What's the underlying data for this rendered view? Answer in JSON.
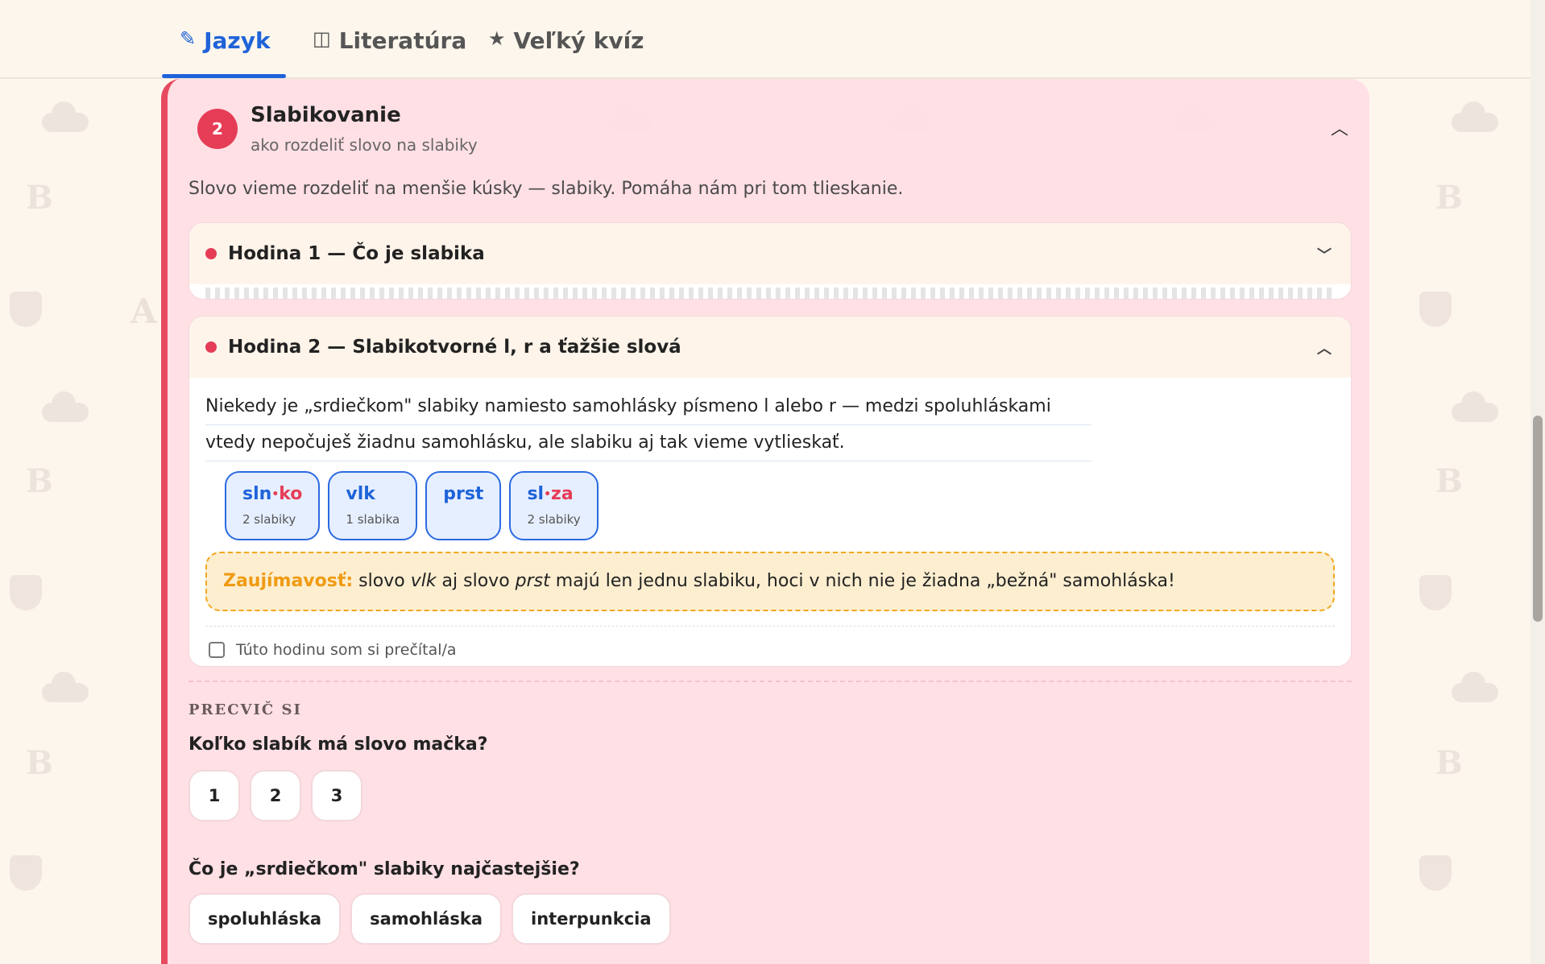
{
  "tabs": [
    {
      "label": "Jazyk",
      "icon": "pencil-icon",
      "active": true
    },
    {
      "label": "Literatúra",
      "icon": "book-icon",
      "active": false
    },
    {
      "label": "Veľký kvíz",
      "icon": "star-icon",
      "active": false
    }
  ],
  "section": {
    "number": "2",
    "title": "Slabikovanie",
    "subtitle": "ako rozdeliť slovo na slabiky",
    "description": "Slovo vieme rozdeliť na menšie kúsky — slabiky. Pomáha nám pri tom tlieskanie."
  },
  "lessons": [
    {
      "title": "Hodina 1 — Čo je slabika",
      "expanded": false
    },
    {
      "title": "Hodina 2 — Slabikotvorné l, r a ťažšie slová",
      "expanded": true,
      "lines": [
        "Niekedy je „srdiečkom\" slabiky namiesto samohlásky písmeno l alebo r — medzi spoluhláskami",
        "vtedy nepočuješ žiadnu samohlásku, ale slabiku aj tak vieme vytlieskať."
      ],
      "chips": [
        {
          "a": "sln",
          "sep": "•",
          "b": "ko",
          "count": "2 slabiky"
        },
        {
          "a": "vlk",
          "sep": "",
          "b": "",
          "count": "1 slabika"
        },
        {
          "a": "prst",
          "sep": "",
          "b": "",
          "count": ""
        },
        {
          "a": "sl",
          "sep": "•",
          "b": "za",
          "count": "2 slabiky"
        }
      ],
      "fact": {
        "label": "Zaujímavosť:",
        "p1": " slovo ",
        "w1": "vlk",
        "p2": " aj slovo ",
        "w2": "prst",
        "p3": " majú len jednu slabiku, hoci v nich nie je žiadna „bežná\" samohláska!"
      },
      "read_label": "Túto hodinu som si prečítal/a"
    }
  ],
  "practice": {
    "heading": "PRECVIČ SI",
    "questions": [
      {
        "text": "Koľko slabík má slovo mačka?",
        "options": [
          "1",
          "2",
          "3"
        ]
      },
      {
        "text": "Čo je „srdiečkom\" slabiky najčastejšie?",
        "options": [
          "spoluhláska",
          "samohláska",
          "interpunkcia"
        ]
      }
    ]
  },
  "colors": {
    "accent": "#1f63d9",
    "section": "#e63d57",
    "fact": "#ef9b13"
  }
}
